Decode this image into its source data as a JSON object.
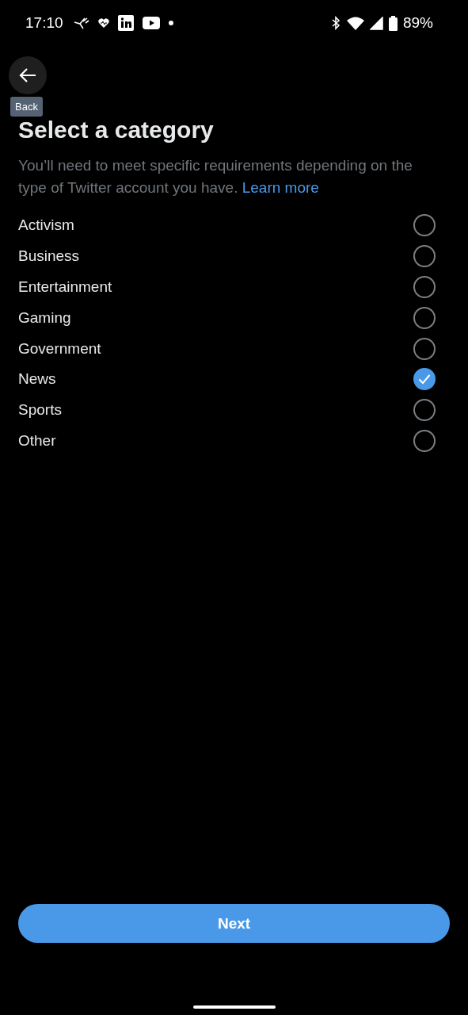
{
  "status_bar": {
    "time": "17:10",
    "battery": "89%"
  },
  "back_button": {
    "tooltip": "Back"
  },
  "title": "Select a category",
  "description": {
    "text": "You’ll need to meet specific requirements depending on the type of Twitter account you have.",
    "link": "Learn more"
  },
  "categories": [
    {
      "label": "Activism",
      "selected": false
    },
    {
      "label": "Business",
      "selected": false
    },
    {
      "label": "Entertainment",
      "selected": false
    },
    {
      "label": "Gaming",
      "selected": false
    },
    {
      "label": "Government",
      "selected": false
    },
    {
      "label": "News",
      "selected": true
    },
    {
      "label": "Sports",
      "selected": false
    },
    {
      "label": "Other",
      "selected": false
    }
  ],
  "next_button": {
    "label": "Next"
  }
}
